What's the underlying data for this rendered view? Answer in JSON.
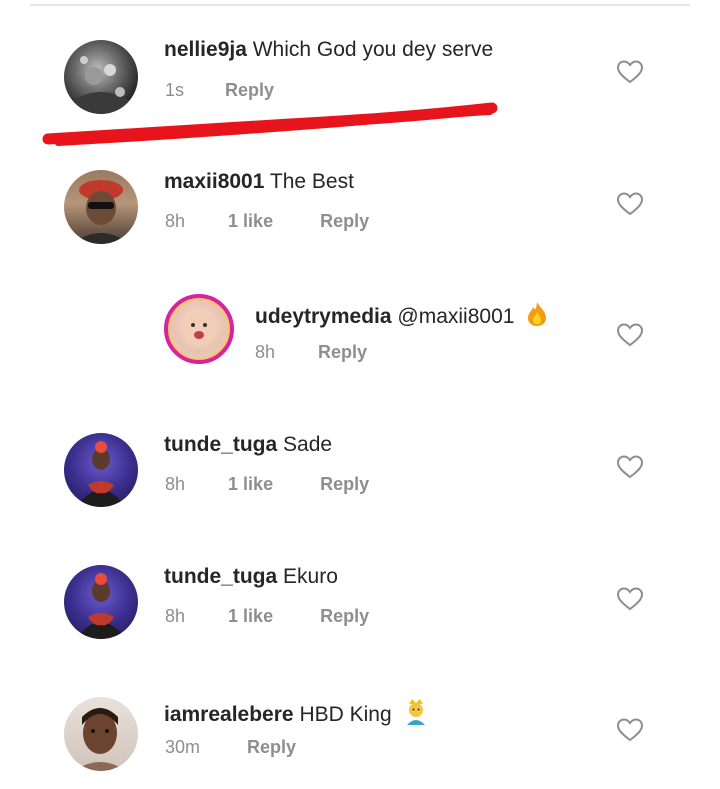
{
  "comments": [
    {
      "username": "nellie9ja",
      "text": "Which God you dey serve",
      "time": "1s",
      "likes": "",
      "reply": "Reply"
    },
    {
      "username": "maxii8001",
      "text": "The Best",
      "time": "8h",
      "likes": "1 like",
      "reply": "Reply"
    },
    {
      "username": "udeytrymedia",
      "text": "@maxii8001",
      "time": "8h",
      "likes": "",
      "reply": "Reply",
      "emoji": "fire-emoji"
    },
    {
      "username": "tunde_tuga",
      "text": "Sade",
      "time": "8h",
      "likes": "1 like",
      "reply": "Reply"
    },
    {
      "username": "tunde_tuga",
      "text": "Ekuro",
      "time": "8h",
      "likes": "1 like",
      "reply": "Reply"
    },
    {
      "username": "iamrealebere",
      "text": "HBD King",
      "time": "30m",
      "likes": "",
      "reply": "Reply",
      "emoji": "prince-emoji"
    }
  ],
  "colors": {
    "annotation_red": "#e8141c",
    "meta_grey": "#8e8e8e",
    "text": "#262626",
    "story_ring": "#d6249f"
  },
  "icons": [
    "heart-outline-icon",
    "fire-emoji",
    "prince-emoji"
  ]
}
